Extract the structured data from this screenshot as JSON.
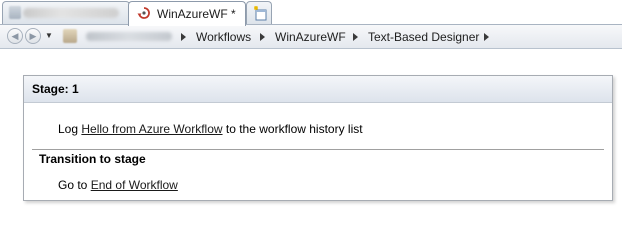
{
  "tabs": [
    {
      "label": "",
      "blurred": true
    },
    {
      "label": "WinAzureWF *",
      "active": true,
      "icon": "workflow-icon"
    },
    {
      "label": "",
      "icon": "new-tab-icon"
    }
  ],
  "breadcrumb": {
    "items": [
      "Workflows",
      "WinAzureWF",
      "Text-Based Designer"
    ]
  },
  "stage": {
    "title": "Stage: 1",
    "action": {
      "prefix": "Log",
      "link": "Hello from Azure Workflow",
      "suffix": "to the workflow history list"
    },
    "transition_title": "Transition to stage",
    "goto": {
      "prefix": "Go to",
      "link": "End of Workflow"
    }
  }
}
